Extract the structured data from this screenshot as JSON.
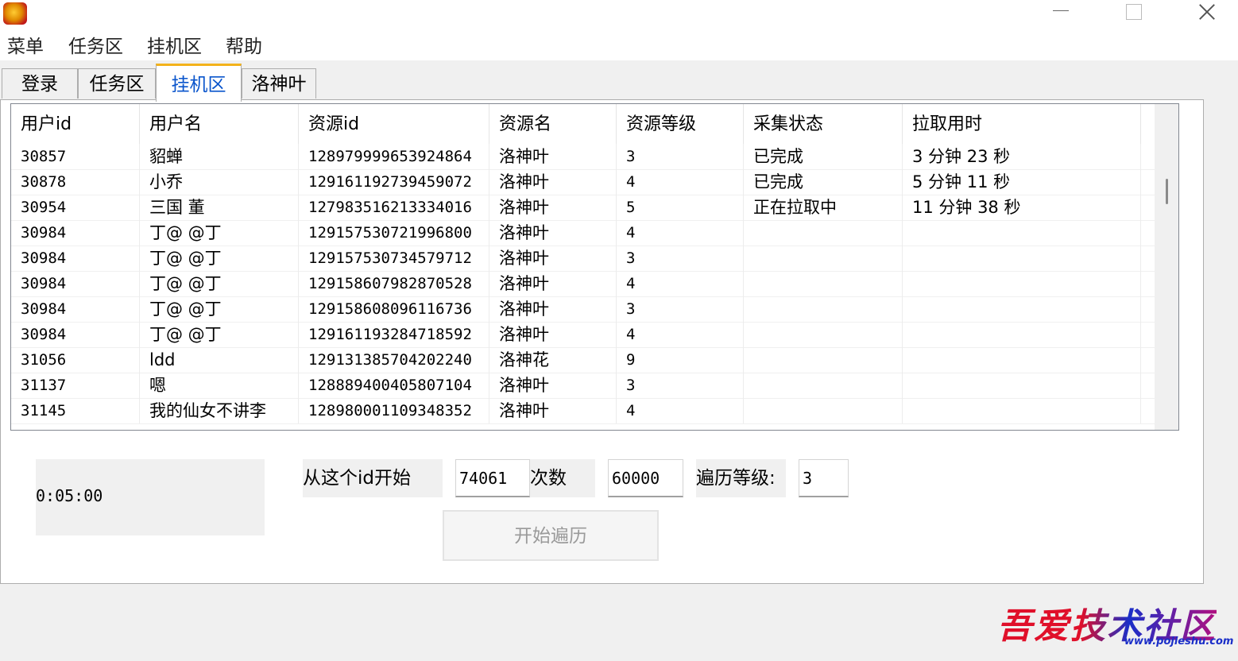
{
  "menu": [
    "菜单",
    "任务区",
    "挂机区",
    "帮助"
  ],
  "tabs": [
    {
      "label": "登录",
      "active": false
    },
    {
      "label": "任务区",
      "active": false
    },
    {
      "label": "挂机区",
      "active": true
    },
    {
      "label": "洛神叶",
      "active": false
    }
  ],
  "table": {
    "columns": [
      "用户id",
      "用户名",
      "资源id",
      "资源名",
      "资源等级",
      "采集状态",
      "拉取用时"
    ],
    "rows": [
      [
        "30857",
        "貂蝉",
        "128979999653924864",
        "洛神叶",
        "3",
        "已完成",
        " 3 分钟 23 秒"
      ],
      [
        "30878",
        "小乔",
        "129161192739459072",
        "洛神叶",
        "4",
        "已完成",
        " 5 分钟 11 秒"
      ],
      [
        "30954",
        "三国 董",
        "127983516213334016",
        "洛神叶",
        "5",
        "正在拉取中",
        " 11 分钟 38 秒"
      ],
      [
        "30984",
        "丁@  @丁",
        "129157530721996800",
        "洛神叶",
        "4",
        "",
        ""
      ],
      [
        "30984",
        "丁@  @丁",
        "129157530734579712",
        "洛神叶",
        "3",
        "",
        ""
      ],
      [
        "30984",
        "丁@  @丁",
        "129158607982870528",
        "洛神叶",
        "4",
        "",
        ""
      ],
      [
        "30984",
        "丁@  @丁",
        "129158608096116736",
        "洛神叶",
        "3",
        "",
        ""
      ],
      [
        "30984",
        "丁@  @丁",
        "129161193284718592",
        "洛神叶",
        "4",
        "",
        ""
      ],
      [
        "31056",
        "ldd",
        "129131385704202240",
        "洛神花",
        "9",
        "",
        ""
      ],
      [
        "31137",
        "嗯",
        "128889400405807104",
        "洛神叶",
        "3",
        "",
        ""
      ],
      [
        "31145",
        "我的仙女不讲李",
        "128980001109348352",
        "洛神叶",
        "4",
        "",
        ""
      ]
    ]
  },
  "controls": {
    "timer": "0:05:00",
    "start_id_label": "从这个id开始",
    "start_id_value": "74061",
    "count_label": "次数",
    "count_value": "60000",
    "level_label": "遍历等级:",
    "level_value": "3",
    "start_button": "开始遍历"
  },
  "watermark": {
    "text": "吾爱技术社区",
    "url": "www.pojieshu.com"
  }
}
